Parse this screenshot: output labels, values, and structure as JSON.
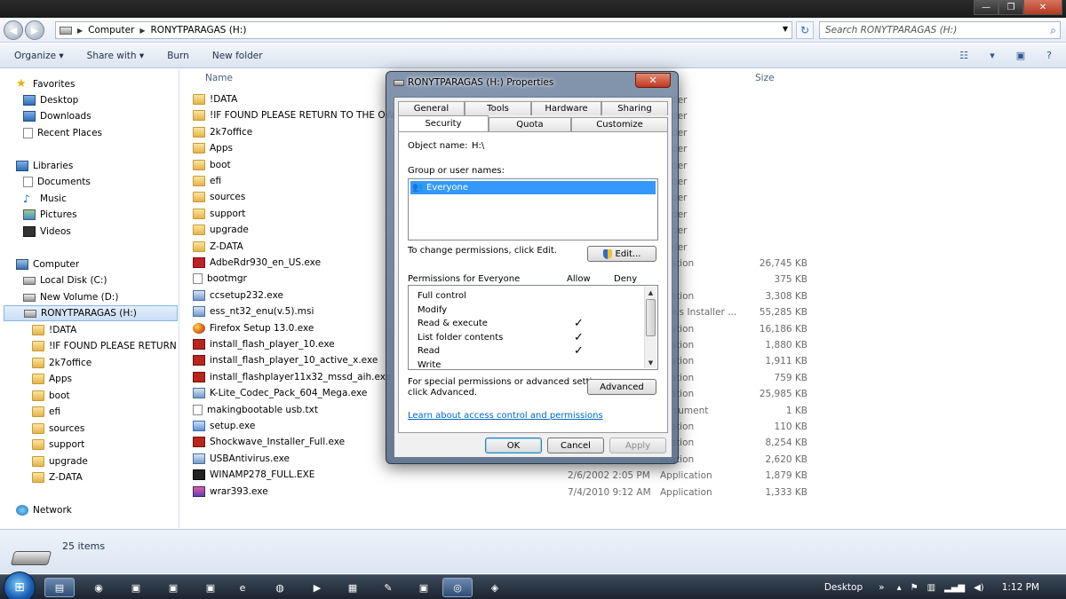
{
  "window": {
    "min_glyph": "—",
    "max_glyph": "❐",
    "close_glyph": "✕"
  },
  "address": {
    "crumbs": [
      "Computer",
      "RONYTPARAGAS (H:)"
    ],
    "search_placeholder": "Search RONYTPARAGAS (H:)"
  },
  "toolbar": {
    "organize": "Organize ▾",
    "share": "Share with ▾",
    "burn": "Burn",
    "new_folder": "New folder"
  },
  "nav": {
    "favorites": "Favorites",
    "fav_items": [
      "Desktop",
      "Downloads",
      "Recent Places"
    ],
    "libraries": "Libraries",
    "lib_items": [
      "Documents",
      "Music",
      "Pictures",
      "Videos"
    ],
    "computer": "Computer",
    "drives": [
      "Local Disk (C:)",
      "New Volume (D:)",
      "RONYTPARAGAS (H:)"
    ],
    "drive_children": [
      "!DATA",
      "!IF FOUND PLEASE RETURN TO",
      "2k7office",
      "Apps",
      "boot",
      "efi",
      "sources",
      "support",
      "upgrade",
      "Z-DATA"
    ],
    "network": "Network"
  },
  "columns": {
    "name": "Name",
    "size": "Size"
  },
  "files": [
    {
      "name": "!DATA",
      "date": "",
      "type": "folder",
      "size": "",
      "icon": "folder"
    },
    {
      "name": "!IF FOUND PLEASE RETURN TO THE OWNE",
      "date": "",
      "type": "folder",
      "size": "",
      "icon": "folder"
    },
    {
      "name": "2k7office",
      "date": "",
      "type": "folder",
      "size": "",
      "icon": "folder"
    },
    {
      "name": "Apps",
      "date": "",
      "type": "folder",
      "size": "",
      "icon": "folder"
    },
    {
      "name": "boot",
      "date": "",
      "type": "folder",
      "size": "",
      "icon": "folder"
    },
    {
      "name": "efi",
      "date": "",
      "type": "folder",
      "size": "",
      "icon": "folder"
    },
    {
      "name": "sources",
      "date": "",
      "type": "folder",
      "size": "",
      "icon": "folder"
    },
    {
      "name": "support",
      "date": "",
      "type": "folder",
      "size": "",
      "icon": "folder"
    },
    {
      "name": "upgrade",
      "date": "",
      "type": "folder",
      "size": "",
      "icon": "folder"
    },
    {
      "name": "Z-DATA",
      "date": "",
      "type": "folder",
      "size": "",
      "icon": "folder"
    },
    {
      "name": "AdbeRdr930_en_US.exe",
      "date": "",
      "type": "lication",
      "size": "26,745 KB",
      "icon": "adobe"
    },
    {
      "name": "bootmgr",
      "date": "",
      "type": "",
      "size": "375 KB",
      "icon": "txt"
    },
    {
      "name": "ccsetup232.exe",
      "date": "",
      "type": "lication",
      "size": "3,308 KB",
      "icon": "exe"
    },
    {
      "name": "ess_nt32_enu(v.5).msi",
      "date": "",
      "type": "dows Installer ...",
      "size": "55,285 KB",
      "icon": "exe"
    },
    {
      "name": "Firefox Setup 13.0.exe",
      "date": "",
      "type": "lication",
      "size": "16,186 KB",
      "icon": "ff"
    },
    {
      "name": "install_flash_player_10.exe",
      "date": "",
      "type": "lication",
      "size": "1,880 KB",
      "icon": "flash"
    },
    {
      "name": "install_flash_player_10_active_x.exe",
      "date": "",
      "type": "lication",
      "size": "1,911 KB",
      "icon": "flash"
    },
    {
      "name": "install_flashplayer11x32_mssd_aih.exe",
      "date": "",
      "type": "lication",
      "size": "759 KB",
      "icon": "flash"
    },
    {
      "name": "K-Lite_Codec_Pack_604_Mega.exe",
      "date": "",
      "type": "lication",
      "size": "25,985 KB",
      "icon": "exe"
    },
    {
      "name": "makingbootable usb.txt",
      "date": "",
      "type": " Document",
      "size": "1 KB",
      "icon": "txt"
    },
    {
      "name": "setup.exe",
      "date": "",
      "type": "lication",
      "size": "110 KB",
      "icon": "setup"
    },
    {
      "name": "Shockwave_Installer_Full.exe",
      "date": "",
      "type": "lication",
      "size": "8,254 KB",
      "icon": "flash"
    },
    {
      "name": "USBAntivirus.exe",
      "date": "",
      "type": "lication",
      "size": "2,620 KB",
      "icon": "exe"
    },
    {
      "name": "WINAMP278_FULL.EXE",
      "date": "2/6/2002 2:05 PM",
      "type": "Application",
      "size": "1,879 KB",
      "icon": "winamp"
    },
    {
      "name": "wrar393.exe",
      "date": "7/4/2010 9:12 AM",
      "type": "Application",
      "size": "1,333 KB",
      "icon": "rar"
    }
  ],
  "status": {
    "count": "25 items"
  },
  "taskbar": {
    "desktop": "Desktop",
    "chevron": "»",
    "time": "1:12 PM"
  },
  "dialog": {
    "title": "RONYTPARAGAS (H:) Properties",
    "tabs_row1": [
      "General",
      "Tools",
      "Hardware",
      "Sharing"
    ],
    "tabs_row2": [
      "Security",
      "Quota",
      "Customize"
    ],
    "object_label": "Object name:",
    "object_value": "H:\\",
    "group_label": "Group or user names:",
    "selected_user": "Everyone",
    "change_text": "To change permissions, click Edit.",
    "edit_btn": "Edit...",
    "perm_label": "Permissions for Everyone",
    "allow": "Allow",
    "deny": "Deny",
    "permissions": [
      {
        "name": "Full control",
        "allow": "",
        "deny": ""
      },
      {
        "name": "Modify",
        "allow": "",
        "deny": ""
      },
      {
        "name": "Read & execute",
        "allow": "✓",
        "deny": ""
      },
      {
        "name": "List folder contents",
        "allow": "✓",
        "deny": ""
      },
      {
        "name": "Read",
        "allow": "✓",
        "deny": ""
      },
      {
        "name": "Write",
        "allow": "",
        "deny": ""
      }
    ],
    "special_text_1": "For special permissions or advanced settings,",
    "special_text_2": "click Advanced.",
    "advanced_btn": "Advanced",
    "learn_link": "Learn about access control and permissions",
    "ok": "OK",
    "cancel": "Cancel",
    "apply": "Apply"
  }
}
